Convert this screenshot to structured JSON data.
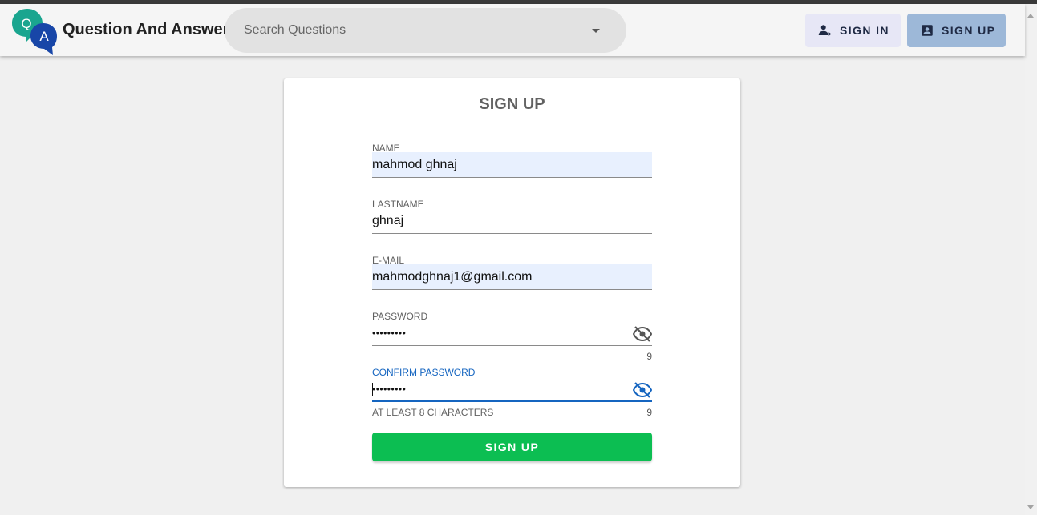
{
  "header": {
    "logo_letters": [
      "Q",
      "A"
    ],
    "app_title": "Question And Answer",
    "search": {
      "placeholder": "Search Questions",
      "value": ""
    },
    "signin_label": "SIGN IN",
    "signup_label": "SIGN UP"
  },
  "form": {
    "title": "SIGN UP",
    "fields": [
      {
        "label": "NAME",
        "value": "mahmod ghnaj"
      },
      {
        "label": "LASTNAME",
        "value": "ghnaj"
      },
      {
        "label": "E-MAIL",
        "value": "mahmodghnaj1@gmail.com"
      },
      {
        "label": "PASSWORD",
        "value": "•••••••••",
        "counter": "9"
      },
      {
        "label": "CONFIRM PASSWORD",
        "value": "•••••••••",
        "counter": "9",
        "hint": "AT LEAST 8 CHARACTERS"
      }
    ],
    "submit_label": "SIGN UP"
  },
  "colors": {
    "accent": "#1565c0",
    "submit": "#0cbe52",
    "logo_q": "#1aa58f",
    "logo_a": "#1846a8"
  },
  "icons": [
    "search-dropdown-icon",
    "add-person-icon",
    "account-box-icon",
    "visibility-off-icon"
  ]
}
